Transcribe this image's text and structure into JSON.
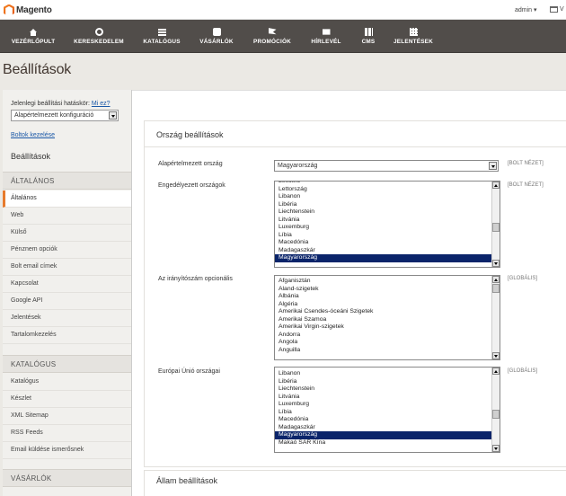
{
  "header": {
    "logo_text": "Magento",
    "user_menu": "admin ▾",
    "store_label": "V"
  },
  "nav": {
    "items": [
      {
        "label": "VEZÉRLŐPULT",
        "icon": "home-icon"
      },
      {
        "label": "KERESKEDELEM",
        "icon": "cart-icon"
      },
      {
        "label": "KATALÓGUS",
        "icon": "catalog-icon"
      },
      {
        "label": "VÁSÁRLÓK",
        "icon": "customers-icon"
      },
      {
        "label": "PROMÓCIÓK",
        "icon": "megaphone-icon"
      },
      {
        "label": "HÍRLEVÉL",
        "icon": "envelope-icon"
      },
      {
        "label": "CMS",
        "icon": "cms-icon"
      },
      {
        "label": "JELENTÉSEK",
        "icon": "reports-icon"
      }
    ]
  },
  "page": {
    "title": "Beállítások"
  },
  "sidebar": {
    "scope_label": "Jelenlegi beállítási hatáskör:",
    "scope_help": "Mi ez?",
    "scope_value": "Alapértelmezett konfiguráció",
    "stores_link": "Boltok kezelése",
    "heading": "Beállítások",
    "groups": [
      {
        "title": "ÁLTALÁNOS",
        "items": [
          "Általános",
          "Web",
          "Külső",
          "Pénznem opciók",
          "Bolt email címek",
          "Kapcsolat",
          "Google API",
          "Jelentések",
          "Tartalomkezelés"
        ]
      },
      {
        "title": "KATALÓGUS",
        "items": [
          "Katalógus",
          "Készlet",
          "XML Sitemap",
          "RSS Feeds",
          "Email küldése ismerősnek"
        ]
      },
      {
        "title": "VÁSÁRLÓK",
        "items": []
      }
    ]
  },
  "main": {
    "section_title": "Ország beállítások",
    "fields": [
      {
        "label": "Alapértelmezett ország",
        "value": "Magyarország",
        "scope": "[BOLT NÉZET]"
      },
      {
        "label": "Engedélyezett országok",
        "scope": "[BOLT NÉZET]",
        "options": [
          "Lesotho",
          "Lettország",
          "Libanon",
          "Libéria",
          "Liechtenstein",
          "Litvánia",
          "Luxemburg",
          "Líbia",
          "Macedónia",
          "Madagaszkár",
          "Magyarország"
        ],
        "selected": "Magyarország"
      },
      {
        "label": "Az irányítószám opcionális",
        "scope": "[GLOBÁLIS]",
        "options": [
          "Afganisztán",
          "Aland-szigetek",
          "Albánia",
          "Algéria",
          "Amerikai Csendes-óceáni Szigetek",
          "Amerikai Szamoa",
          "Amerikai Virgin-szigetek",
          "Andorra",
          "Angola",
          "Anguilla"
        ],
        "selected": ""
      },
      {
        "label": "Európai Únió országai",
        "scope": "[GLOBÁLIS]",
        "options": [
          "Libanon",
          "Libéria",
          "Liechtenstein",
          "Litvánia",
          "Luxemburg",
          "Líbia",
          "Macedónia",
          "Madagaszkár",
          "Magyarország",
          "Makaó SAR Kína"
        ],
        "selected": "Magyarország"
      }
    ],
    "section2_title": "Állam beállítások"
  }
}
